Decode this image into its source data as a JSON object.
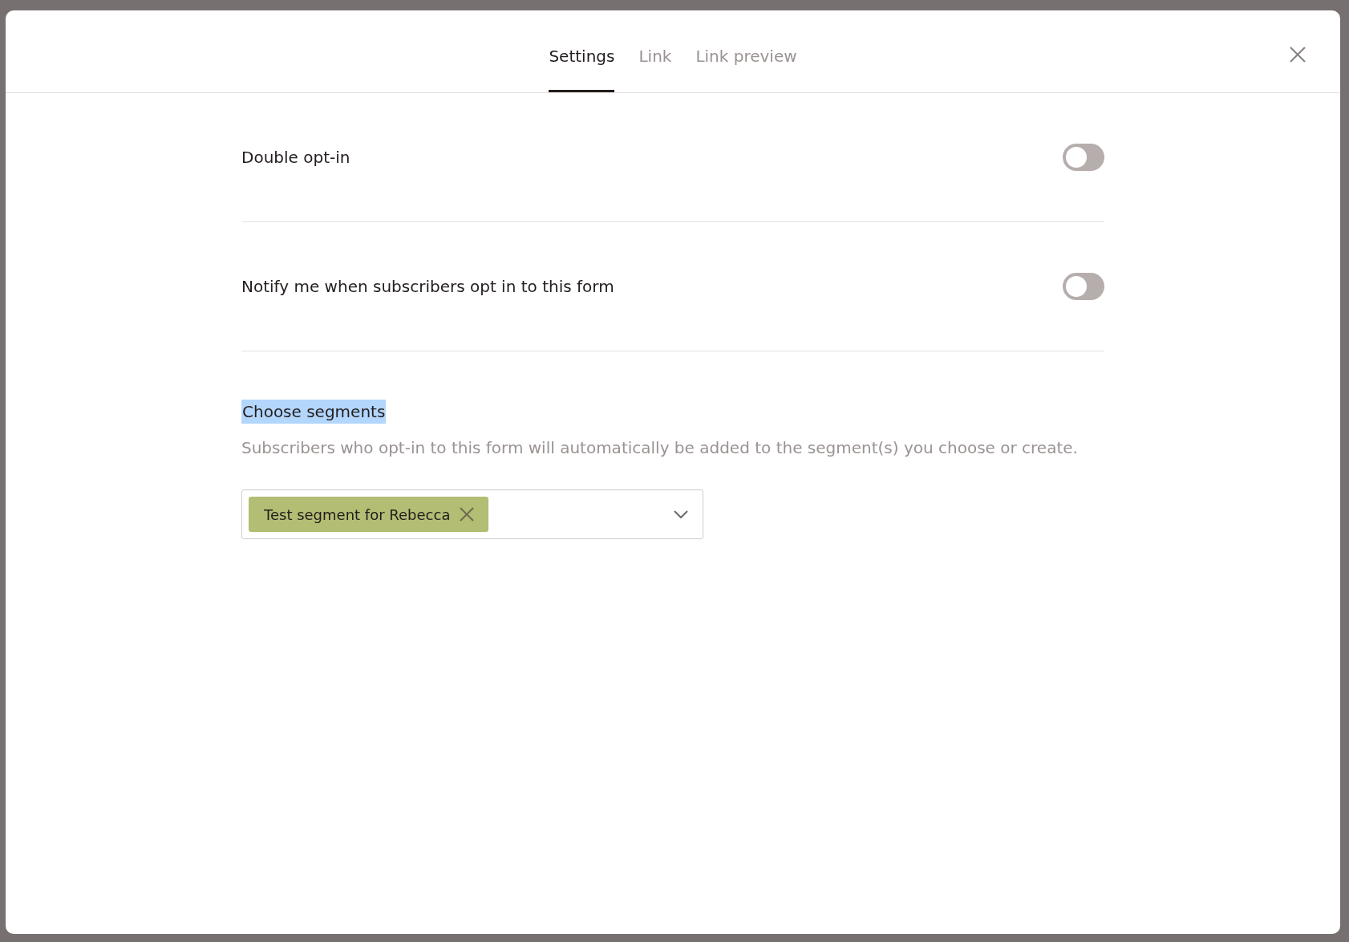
{
  "tabs": [
    {
      "label": "Settings",
      "selected": true
    },
    {
      "label": "Link",
      "selected": false
    },
    {
      "label": "Link preview",
      "selected": false
    }
  ],
  "settings": [
    {
      "label": "Double opt-in",
      "on": false
    },
    {
      "label": "Notify me when subscribers opt in to this form",
      "on": false
    }
  ],
  "segments": {
    "heading": "Choose segments",
    "highlighted": true,
    "description": "Subscribers who opt-in to this form will automatically be added to the segment(s) you choose or create.",
    "tags": [
      {
        "label": "Test segment for Rebecca"
      }
    ]
  }
}
